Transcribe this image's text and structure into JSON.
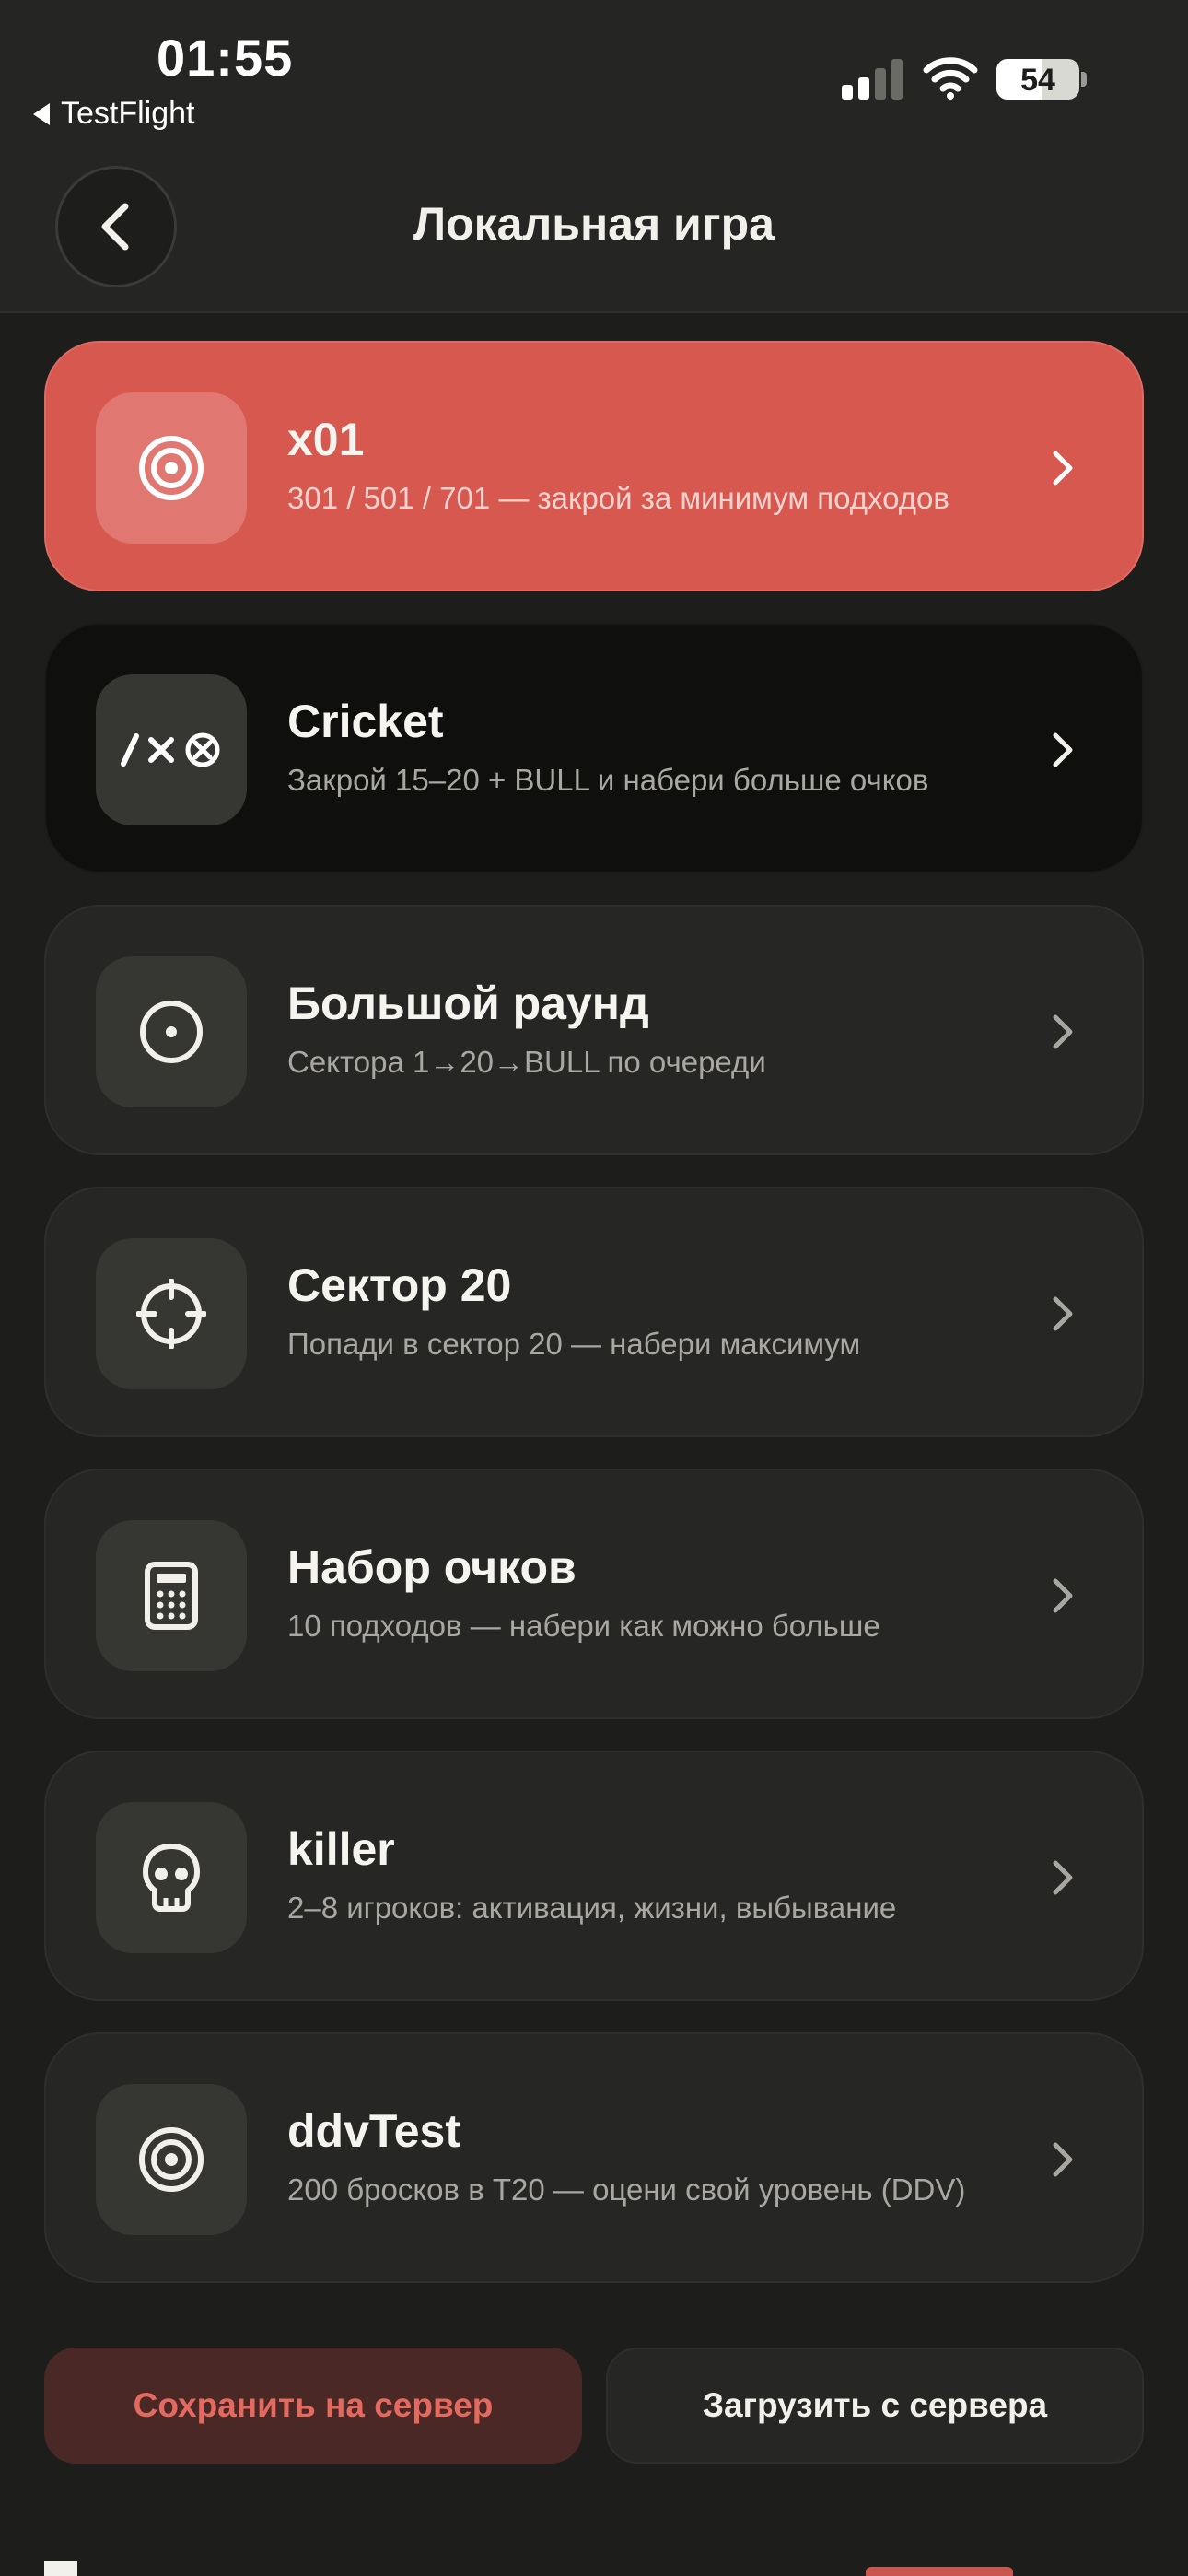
{
  "status": {
    "time": "01:55",
    "back_app": "TestFlight",
    "battery_percent": "54",
    "battery_level": 0.54
  },
  "nav": {
    "title": "Локальная игра"
  },
  "modes": [
    {
      "title": "x01",
      "subtitle": "301 / 501 / 701 — закрой за минимум подходов",
      "icon": "target-icon",
      "state": "active"
    },
    {
      "title": "Cricket",
      "subtitle": "Закрой 15–20 + BULL и набери больше очков",
      "icon": "cricket-marks-icon",
      "state": "dark"
    },
    {
      "title": "Большой раунд",
      "subtitle": "Сектора 1→20→BULL по очереди",
      "icon": "circle-dot-icon",
      "state": "normal"
    },
    {
      "title": "Сектор 20",
      "subtitle": "Попади в сектор 20 — набери максимум",
      "icon": "crosshair-icon",
      "state": "normal"
    },
    {
      "title": "Набор очков",
      "subtitle": "10 подходов — набери как можно больше",
      "icon": "calculator-icon",
      "state": "normal"
    },
    {
      "title": "killer",
      "subtitle": "2–8 игроков: активация, жизни, выбывание",
      "icon": "skull-icon",
      "state": "normal"
    },
    {
      "title": "ddvTest",
      "subtitle": "200 бросков в T20 — оцени свой уровень (DDV)",
      "icon": "target-icon",
      "state": "normal"
    }
  ],
  "actions": {
    "save": "Сохранить на сервер",
    "load": "Загрузить с сервера"
  },
  "colors": {
    "background": "#1d1d1b",
    "accent": "#d6584f",
    "card": "#262624"
  }
}
